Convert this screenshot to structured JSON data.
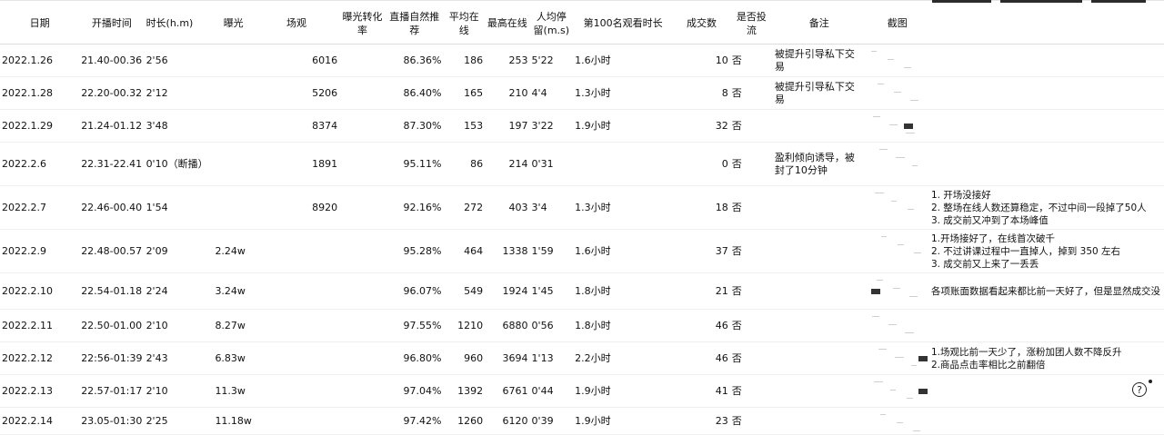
{
  "headers": [
    "日期",
    "开播时间",
    "时长(h.m)",
    "曝光",
    "场观",
    "曝光转化率",
    "直播自然推荐",
    "平均在线",
    "最高在线",
    "人均停留(m.s)",
    "第100名观看时长",
    "成交数",
    "是否投流",
    "备注",
    "截图",
    "",
    ""
  ],
  "rows": [
    {
      "date": "2022.1.26",
      "start": "21.40-00.36",
      "dur": "2'56",
      "exposure": "",
      "views": "6016",
      "conv": "",
      "natural": "86.36%",
      "avg": "186",
      "peak": "253",
      "stay": "5'22",
      "t100": "1.6小时",
      "deals": "10",
      "paid": "否",
      "note": "被提升引导私下交易",
      "notes2": []
    },
    {
      "date": "2022.1.28",
      "start": "22.20-00.32",
      "dur": "2'12",
      "exposure": "",
      "views": "5206",
      "conv": "",
      "natural": "86.40%",
      "avg": "165",
      "peak": "210",
      "stay": "4'4",
      "t100": "1.3小时",
      "deals": "8",
      "paid": "否",
      "note": "被提升引导私下交易",
      "notes2": []
    },
    {
      "date": "2022.1.29",
      "start": "21.24-01.12",
      "dur": "3'48",
      "exposure": "",
      "views": "8374",
      "conv": "",
      "natural": "87.30%",
      "avg": "153",
      "peak": "197",
      "stay": "3'22",
      "t100": "1.9小时",
      "deals": "32",
      "paid": "否",
      "note": "",
      "notes2": []
    },
    {
      "date": "2022.2.6",
      "start": "22.31-22.41",
      "dur": "0'10（断播）",
      "exposure": "",
      "views": "1891",
      "conv": "",
      "natural": "95.11%",
      "avg": "86",
      "peak": "214",
      "stay": "0'31",
      "t100": "",
      "deals": "0",
      "paid": "否",
      "note": "盈利倾向诱导，被封了10分钟",
      "notes2": []
    },
    {
      "date": "2022.2.7",
      "start": "22.46-00.40",
      "dur": "1'54",
      "exposure": "",
      "views": "8920",
      "conv": "",
      "natural": "92.16%",
      "avg": "272",
      "peak": "403",
      "stay": "3'4",
      "t100": "1.3小时",
      "deals": "18",
      "paid": "否",
      "note": "",
      "notes2": [
        "1. 开场没接好",
        "2. 整场在线人数还算稳定，不过中间一段掉了50人",
        "3. 成交前又冲到了本场峰值"
      ]
    },
    {
      "date": "2022.2.9",
      "start": "22.48-00.57",
      "dur": "2'09",
      "exposure": "2.24w",
      "views": "",
      "conv": "",
      "natural": "95.28%",
      "avg": "464",
      "peak": "1338",
      "stay": "1'59",
      "t100": "1.6小时",
      "deals": "37",
      "paid": "否",
      "note": "",
      "notes2": [
        "1.开场接好了，在线首次破千",
        "2. 不过讲课过程中一直掉人，掉到 350 左右",
        "3. 成交前又上来了一丢丢"
      ]
    },
    {
      "date": "2022.2.10",
      "start": "22.54-01.18",
      "dur": "2'24",
      "exposure": "3.24w",
      "views": "",
      "conv": "",
      "natural": "96.07%",
      "avg": "549",
      "peak": "1924",
      "stay": "1'45",
      "t100": "1.8小时",
      "deals": "21",
      "paid": "否",
      "note": "",
      "notes2": [
        "各项账面数据看起来都比前一天好了，但是显然成交没"
      ]
    },
    {
      "date": "2022.2.11",
      "start": "22.50-01.00",
      "dur": "2'10",
      "exposure": "8.27w",
      "views": "",
      "conv": "",
      "natural": "97.55%",
      "avg": "1210",
      "peak": "6880",
      "stay": "0'56",
      "t100": "1.8小时",
      "deals": "46",
      "paid": "否",
      "note": "",
      "notes2": []
    },
    {
      "date": "2022.2.12",
      "start": "22:56-01:39",
      "dur": "2'43",
      "exposure": "6.83w",
      "views": "",
      "conv": "",
      "natural": "96.80%",
      "avg": "960",
      "peak": "3694",
      "stay": "1'13",
      "t100": "2.2小时",
      "deals": "46",
      "paid": "否",
      "note": "",
      "notes2": [
        "1.场观比前一天少了，涨粉加团人数不降反升",
        "2.商品点击率相比之前翻倍"
      ]
    },
    {
      "date": "2022.2.13",
      "start": "22.57-01:17",
      "dur": "2'10",
      "exposure": "11.3w",
      "views": "",
      "conv": "",
      "natural": "97.04%",
      "avg": "1392",
      "peak": "6761",
      "stay": "0'44",
      "t100": "1.9小时",
      "deals": "41",
      "paid": "否",
      "note": "",
      "notes2": []
    },
    {
      "date": "2022.2.14",
      "start": "23.05-01:30",
      "dur": "2'25",
      "exposure": "11.18w",
      "views": "",
      "conv": "",
      "natural": "97.42%",
      "avg": "1260",
      "peak": "6120",
      "stay": "0'39",
      "t100": "1.9小时",
      "deals": "23",
      "paid": "否",
      "note": "",
      "notes2": []
    }
  ],
  "help_icon": "question-circle-icon",
  "help_label": "?"
}
